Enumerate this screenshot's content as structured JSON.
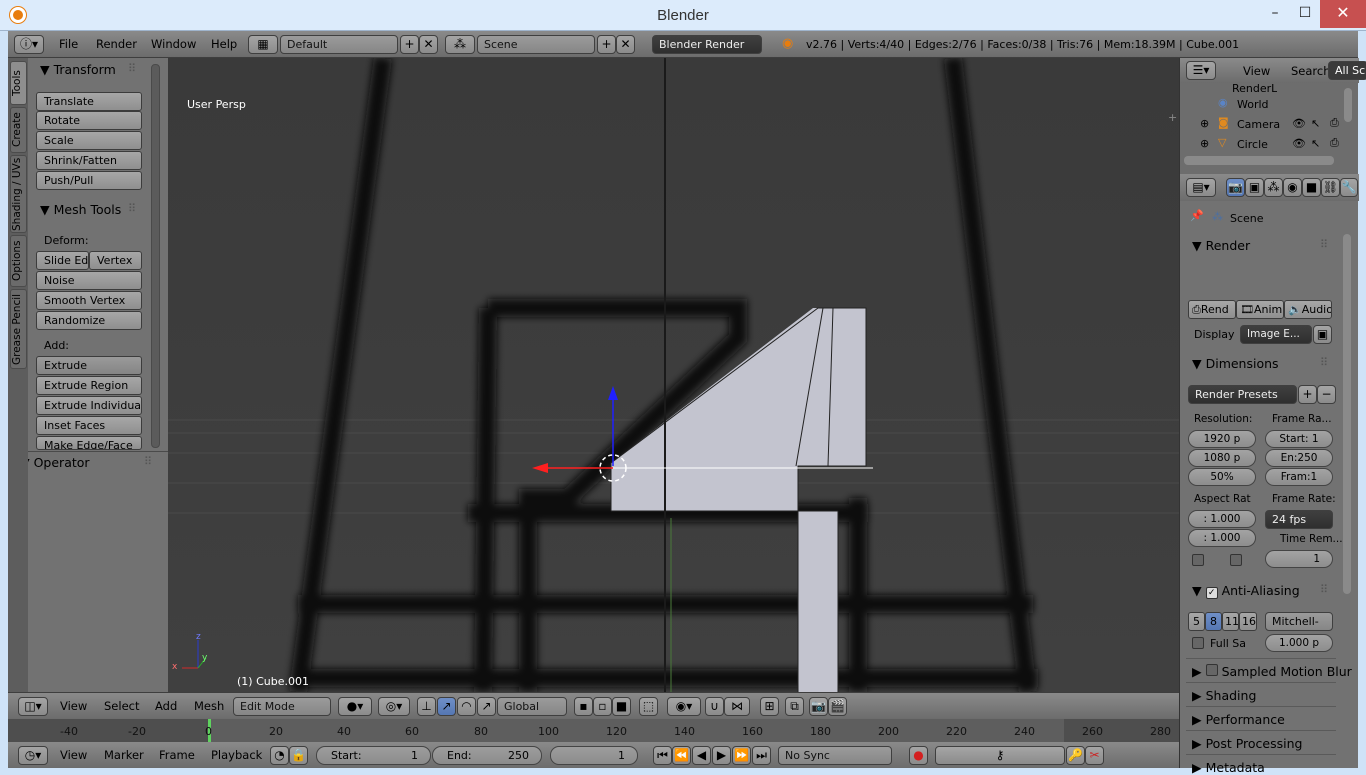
{
  "window": {
    "title": "Blender",
    "minimize": "–",
    "maximize": "☐",
    "close": "✕"
  },
  "topbar": {
    "menus": [
      "File",
      "Render",
      "Window",
      "Help"
    ],
    "layout": "Default",
    "scene": "Scene",
    "engine": "Blender Render",
    "stats": "v2.76 | Verts:4/40 | Edges:2/76 | Faces:0/38 | Tris:76 | Mem:18.39M | Cube.001"
  },
  "toolshelf": {
    "tabs": [
      "Tools",
      "Create",
      "Shading / UVs",
      "Options",
      "Grease Pencil"
    ],
    "transform": {
      "title": "Transform",
      "buttons": [
        "Translate",
        "Rotate",
        "Scale",
        "Shrink/Fatten",
        "Push/Pull"
      ]
    },
    "mesh_tools": {
      "title": "Mesh Tools",
      "deform_label": "Deform:",
      "slide_edge": "Slide Ed",
      "vertex": "Vertex",
      "noise": "Noise",
      "smooth_vertex": "Smooth Vertex",
      "randomize": "Randomize",
      "add_label": "Add:",
      "extrude": "Extrude",
      "extrude_region": "Extrude Region",
      "extrude_individual": "Extrude Individual",
      "inset_faces": "Inset Faces",
      "make_edge_face": "Make Edge/Face"
    },
    "operator": {
      "title": "Operator"
    }
  },
  "viewport": {
    "view_label": "User Persp",
    "object_label": "(1) Cube.001",
    "axis_x": "x",
    "axis_y": "y",
    "axis_z": "z"
  },
  "view3d_header": {
    "view": "View",
    "select": "Select",
    "add": "Add",
    "mesh": "Mesh",
    "mode": "Edit Mode",
    "orientation": "Global"
  },
  "timeline": {
    "ticks": [
      "-40",
      "-20",
      "0",
      "20",
      "40",
      "60",
      "80",
      "100",
      "120",
      "140",
      "160",
      "180",
      "200",
      "220",
      "240",
      "260",
      "280"
    ]
  },
  "timeline_footer": {
    "view": "View",
    "marker": "Marker",
    "frame": "Frame",
    "playback": "Playback",
    "start_label": "Start:",
    "start": "1",
    "end_label": "End:",
    "end": "250",
    "current": "1",
    "sync": "No Sync"
  },
  "outliner": {
    "view": "View",
    "search": "Search",
    "filter": "All Sc",
    "items": [
      "RenderL",
      "World",
      "Camera",
      "Circle"
    ]
  },
  "properties": {
    "scene_label": "Scene",
    "render": {
      "title": "Render",
      "rend": "Rend",
      "anim": "Anim",
      "audio": "Audio",
      "display_label": "Display",
      "display_value": "Image E..."
    },
    "dimensions": {
      "title": "Dimensions",
      "presets": "Render Presets",
      "resolution_label": "Resolution:",
      "res_x": "1920 p",
      "res_y": "1080 p",
      "res_pct": "50%",
      "frame_range_label": "Frame Ra...",
      "start": "Start: 1",
      "end": "En:250",
      "step": "Fram:1",
      "aspect_label": "Aspect Rat",
      "aspect_x": ": 1.000",
      "aspect_y": ": 1.000",
      "frame_rate_label": "Frame Rate:",
      "fps": "24 fps",
      "time_remap_label": "Time Rem...",
      "time_remap": "1"
    },
    "anti_aliasing": {
      "title": "Anti-Aliasing",
      "samples": [
        "5",
        "8",
        "11",
        "16"
      ],
      "filter": "Mitchell-",
      "full_sample": "Full Sa",
      "size": "1.000 p"
    },
    "collapsed": [
      "Sampled Motion Blur",
      "Shading",
      "Performance",
      "Post Processing",
      "Metadata"
    ]
  }
}
